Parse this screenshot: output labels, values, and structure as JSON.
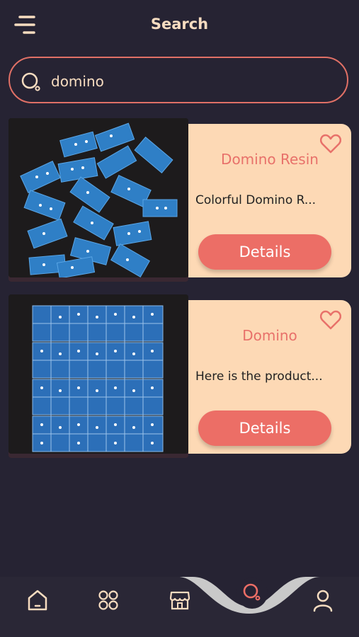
{
  "header": {
    "title": "Search",
    "menu_icon": "menu-icon"
  },
  "search": {
    "value": "domino",
    "placeholder": "",
    "icon": "search-icon"
  },
  "results": [
    {
      "title": "Domino Resin",
      "description": "Colorful Domino R...",
      "button": "Details",
      "favorite_icon": "heart-icon"
    },
    {
      "title": "Domino",
      "description": "Here is the product...",
      "button": "Details",
      "favorite_icon": "heart-icon"
    }
  ],
  "bottom_nav": {
    "items": [
      {
        "name": "home",
        "icon": "home-icon"
      },
      {
        "name": "categories",
        "icon": "grid-icon"
      },
      {
        "name": "store",
        "icon": "store-icon"
      },
      {
        "name": "search",
        "icon": "search-icon",
        "active": true
      },
      {
        "name": "profile",
        "icon": "user-icon"
      }
    ]
  },
  "colors": {
    "background": "#262333",
    "accent": "#ec6e66",
    "card": "#fdd9b5",
    "title_text": "#f7dcc0"
  }
}
